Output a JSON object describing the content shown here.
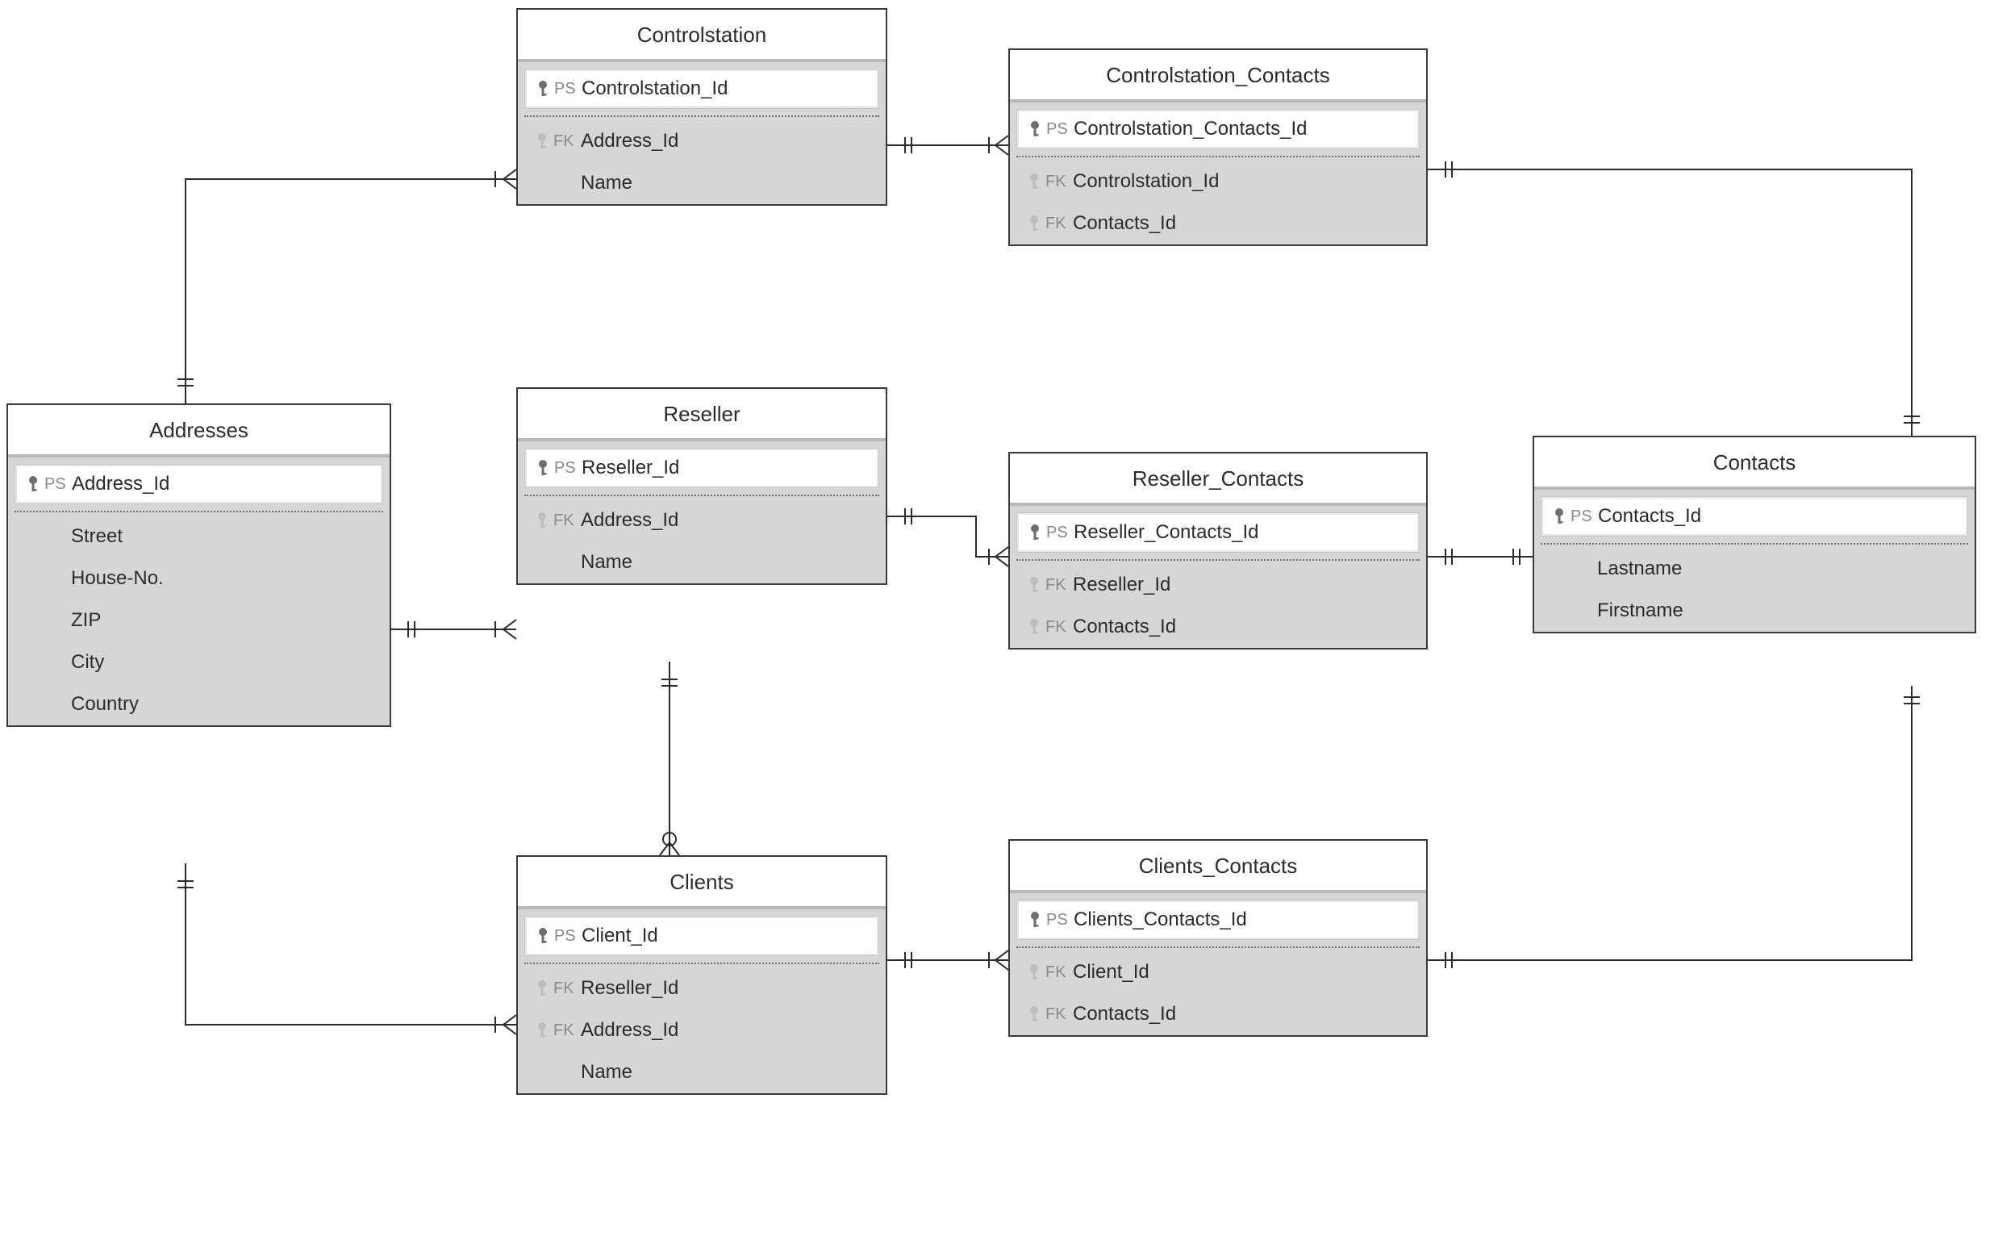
{
  "entities": {
    "controlstation": {
      "title": "Controlstation",
      "pk": {
        "tag": "PS",
        "name": "Controlstation_Id"
      },
      "rows": [
        {
          "tag": "FK",
          "name": "Address_Id"
        },
        {
          "tag": "",
          "name": "Name"
        }
      ]
    },
    "controlstation_contacts": {
      "title": "Controlstation_Contacts",
      "pk": {
        "tag": "PS",
        "name": "Controlstation_Contacts_Id"
      },
      "rows": [
        {
          "tag": "FK",
          "name": "Controlstation_Id"
        },
        {
          "tag": "FK",
          "name": "Contacts_Id"
        }
      ]
    },
    "addresses": {
      "title": "Addresses",
      "pk": {
        "tag": "PS",
        "name": "Address_Id"
      },
      "rows": [
        {
          "tag": "",
          "name": "Street"
        },
        {
          "tag": "",
          "name": "House-No."
        },
        {
          "tag": "",
          "name": "ZIP"
        },
        {
          "tag": "",
          "name": "City"
        },
        {
          "tag": "",
          "name": "Country"
        }
      ]
    },
    "reseller": {
      "title": "Reseller",
      "pk": {
        "tag": "PS",
        "name": "Reseller_Id"
      },
      "rows": [
        {
          "tag": "FK",
          "name": "Address_Id"
        },
        {
          "tag": "",
          "name": "Name"
        }
      ]
    },
    "reseller_contacts": {
      "title": "Reseller_Contacts",
      "pk": {
        "tag": "PS",
        "name": "Reseller_Contacts_Id"
      },
      "rows": [
        {
          "tag": "FK",
          "name": "Reseller_Id"
        },
        {
          "tag": "FK",
          "name": "Contacts_Id"
        }
      ]
    },
    "contacts": {
      "title": "Contacts",
      "pk": {
        "tag": "PS",
        "name": "Contacts_Id"
      },
      "rows": [
        {
          "tag": "",
          "name": "Lastname"
        },
        {
          "tag": "",
          "name": "Firstname"
        }
      ]
    },
    "clients": {
      "title": "Clients",
      "pk": {
        "tag": "PS",
        "name": "Client_Id"
      },
      "rows": [
        {
          "tag": "FK",
          "name": "Reseller_Id"
        },
        {
          "tag": "FK",
          "name": "Address_Id"
        },
        {
          "tag": "",
          "name": "Name"
        }
      ]
    },
    "clients_contacts": {
      "title": "Clients_Contacts",
      "pk": {
        "tag": "PS",
        "name": "Clients_Contacts_Id"
      },
      "rows": [
        {
          "tag": "FK",
          "name": "Client_Id"
        },
        {
          "tag": "FK",
          "name": "Contacts_Id"
        }
      ]
    }
  }
}
